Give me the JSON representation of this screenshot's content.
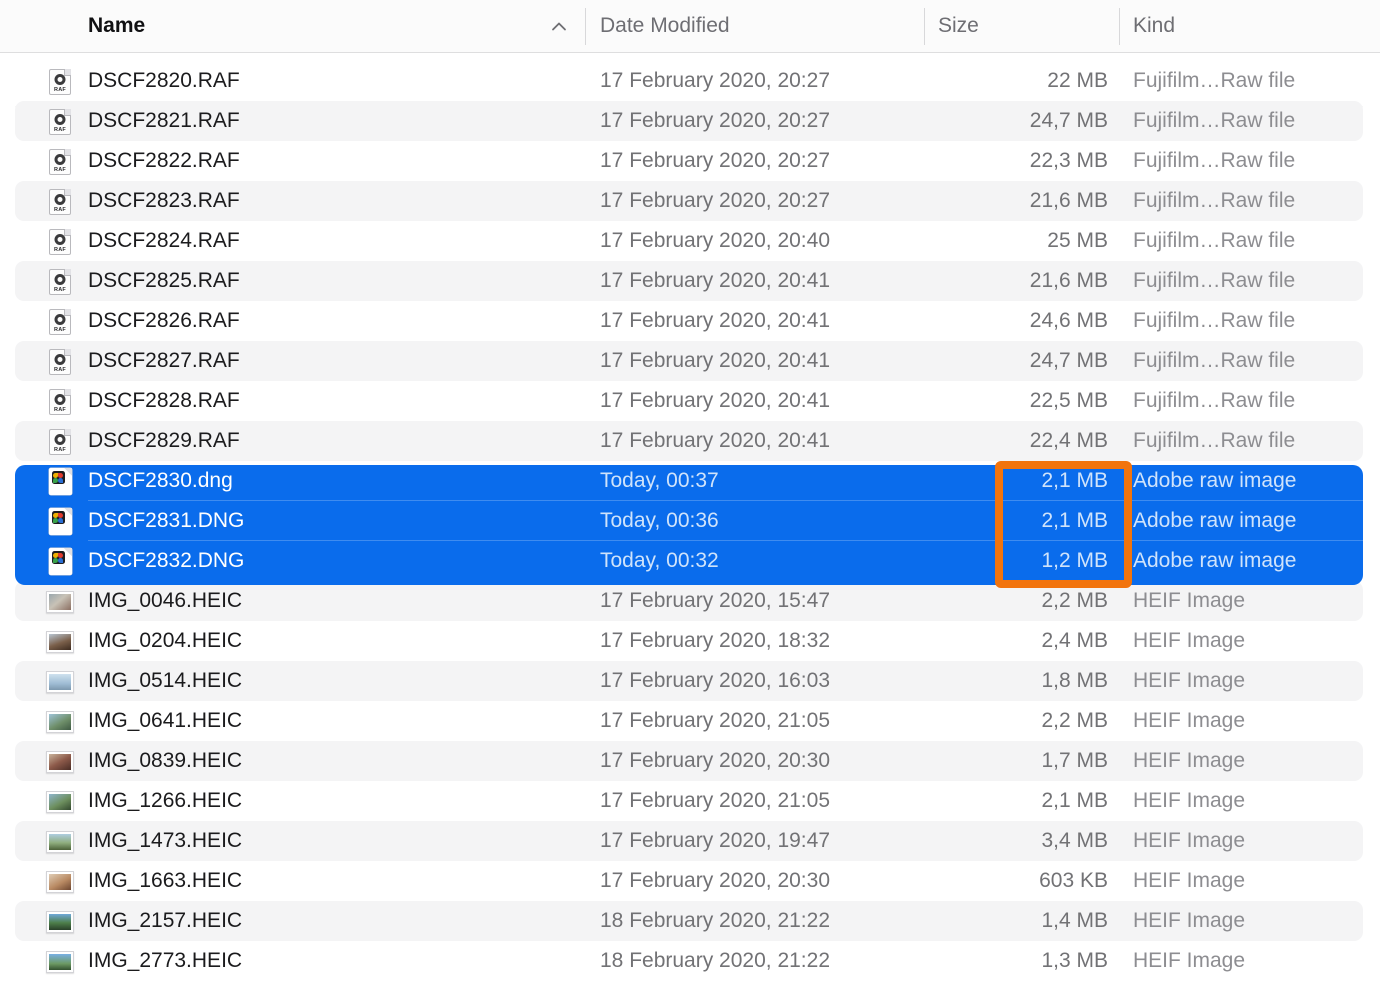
{
  "header": {
    "columns": [
      {
        "id": "name",
        "label": "Name",
        "sorted": true,
        "sort_icon": "chevron-up-icon"
      },
      {
        "id": "date",
        "label": "Date Modified"
      },
      {
        "id": "size",
        "label": "Size"
      },
      {
        "id": "kind",
        "label": "Kind"
      }
    ]
  },
  "colors": {
    "selection_blue": "#0a6cec",
    "annotation_orange": "#f2740d",
    "stripe_gray": "#f4f4f5",
    "header_bg": "#fbfbfb"
  },
  "annotation": {
    "shape": "rectangle-highlight",
    "target_column": "Size",
    "highlighted_values": [
      "2,1 MB",
      "2,1 MB",
      "1,2 MB"
    ]
  },
  "files": [
    {
      "name": "DSCF2820.RAF",
      "date": "17 February 2020, 20:27",
      "size": "22 MB",
      "kind": "Fujifilm…Raw file",
      "icon": "raf-file-icon",
      "selected": false
    },
    {
      "name": "DSCF2821.RAF",
      "date": "17 February 2020, 20:27",
      "size": "24,7 MB",
      "kind": "Fujifilm…Raw file",
      "icon": "raf-file-icon",
      "selected": false
    },
    {
      "name": "DSCF2822.RAF",
      "date": "17 February 2020, 20:27",
      "size": "22,3 MB",
      "kind": "Fujifilm…Raw file",
      "icon": "raf-file-icon",
      "selected": false
    },
    {
      "name": "DSCF2823.RAF",
      "date": "17 February 2020, 20:27",
      "size": "21,6 MB",
      "kind": "Fujifilm…Raw file",
      "icon": "raf-file-icon",
      "selected": false
    },
    {
      "name": "DSCF2824.RAF",
      "date": "17 February 2020, 20:40",
      "size": "25 MB",
      "kind": "Fujifilm…Raw file",
      "icon": "raf-file-icon",
      "selected": false
    },
    {
      "name": "DSCF2825.RAF",
      "date": "17 February 2020, 20:41",
      "size": "21,6 MB",
      "kind": "Fujifilm…Raw file",
      "icon": "raf-file-icon",
      "selected": false
    },
    {
      "name": "DSCF2826.RAF",
      "date": "17 February 2020, 20:41",
      "size": "24,6 MB",
      "kind": "Fujifilm…Raw file",
      "icon": "raf-file-icon",
      "selected": false
    },
    {
      "name": "DSCF2827.RAF",
      "date": "17 February 2020, 20:41",
      "size": "24,7 MB",
      "kind": "Fujifilm…Raw file",
      "icon": "raf-file-icon",
      "selected": false
    },
    {
      "name": "DSCF2828.RAF",
      "date": "17 February 2020, 20:41",
      "size": "22,5 MB",
      "kind": "Fujifilm…Raw file",
      "icon": "raf-file-icon",
      "selected": false
    },
    {
      "name": "DSCF2829.RAF",
      "date": "17 February 2020, 20:41",
      "size": "22,4 MB",
      "kind": "Fujifilm…Raw file",
      "icon": "raf-file-icon",
      "selected": false
    },
    {
      "name": "DSCF2830.dng",
      "date": "Today, 00:37",
      "size": "2,1 MB",
      "kind": "Adobe raw image",
      "icon": "dng-file-icon",
      "selected": true
    },
    {
      "name": "DSCF2831.DNG",
      "date": "Today, 00:36",
      "size": "2,1 MB",
      "kind": "Adobe raw image",
      "icon": "dng-file-icon",
      "selected": true
    },
    {
      "name": "DSCF2832.DNG",
      "date": "Today, 00:32",
      "size": "1,2 MB",
      "kind": "Adobe raw image",
      "icon": "dng-file-icon",
      "selected": true
    },
    {
      "name": "IMG_0046.HEIC",
      "date": "17 February 2020, 15:47",
      "size": "2,2 MB",
      "kind": "HEIF Image",
      "icon": "heic-photo-icon",
      "selected": false,
      "thumb": "linear-gradient(140deg,#9aa7ad 0%,#c8c2b6 45%,#8b6f62 100%)"
    },
    {
      "name": "IMG_0204.HEIC",
      "date": "17 February 2020, 18:32",
      "size": "2,4 MB",
      "kind": "HEIF Image",
      "icon": "heic-photo-icon",
      "selected": false,
      "thumb": "linear-gradient(160deg,#b9c6d2 0%,#7a5f4a 55%,#3d2b20 100%)"
    },
    {
      "name": "IMG_0514.HEIC",
      "date": "17 February 2020, 16:03",
      "size": "1,8 MB",
      "kind": "HEIF Image",
      "icon": "heic-photo-icon",
      "selected": false,
      "thumb": "linear-gradient(180deg,#cfe1ee 0%,#9fbcd4 60%,#7c98ae 100%)"
    },
    {
      "name": "IMG_0641.HEIC",
      "date": "17 February 2020, 21:05",
      "size": "2,2 MB",
      "kind": "HEIF Image",
      "icon": "heic-photo-icon",
      "selected": false,
      "thumb": "linear-gradient(150deg,#9fc4d8 0%,#6f8f6a 55%,#3f5a44 100%)"
    },
    {
      "name": "IMG_0839.HEIC",
      "date": "17 February 2020, 20:30",
      "size": "1,7 MB",
      "kind": "HEIF Image",
      "icon": "heic-photo-icon",
      "selected": false,
      "thumb": "linear-gradient(150deg,#c9b39c 0%,#8d5a4a 50%,#4a2d26 100%)"
    },
    {
      "name": "IMG_1266.HEIC",
      "date": "17 February 2020, 21:05",
      "size": "2,1 MB",
      "kind": "HEIF Image",
      "icon": "heic-photo-icon",
      "selected": false,
      "thumb": "linear-gradient(150deg,#8fb6cc 0%,#6d8f5e 55%,#33492f 100%)"
    },
    {
      "name": "IMG_1473.HEIC",
      "date": "17 February 2020, 19:47",
      "size": "3,4 MB",
      "kind": "HEIF Image",
      "icon": "heic-photo-icon",
      "selected": false,
      "thumb": "linear-gradient(180deg,#aecde0 0%,#8fae7e 55%,#4b6138 100%)"
    },
    {
      "name": "IMG_1663.HEIC",
      "date": "17 February 2020, 20:30",
      "size": "603 KB",
      "kind": "HEIF Image",
      "icon": "heic-photo-icon",
      "selected": false,
      "thumb": "linear-gradient(150deg,#e0cdb6 0%,#b98a63 55%,#6d4630 100%)"
    },
    {
      "name": "IMG_2157.HEIC",
      "date": "18 February 2020, 21:22",
      "size": "1,4 MB",
      "kind": "HEIF Image",
      "icon": "heic-photo-icon",
      "selected": false,
      "thumb": "linear-gradient(180deg,#6fa8d8 0%,#4e7f4a 55%,#29402a 100%)"
    },
    {
      "name": "IMG_2773.HEIC",
      "date": "18 February 2020, 21:22",
      "size": "1,3 MB",
      "kind": "HEIF Image",
      "icon": "heic-photo-icon",
      "selected": false,
      "thumb": "linear-gradient(180deg,#79b0e4 0%,#6d9a64 60%,#33502f 100%)"
    }
  ]
}
